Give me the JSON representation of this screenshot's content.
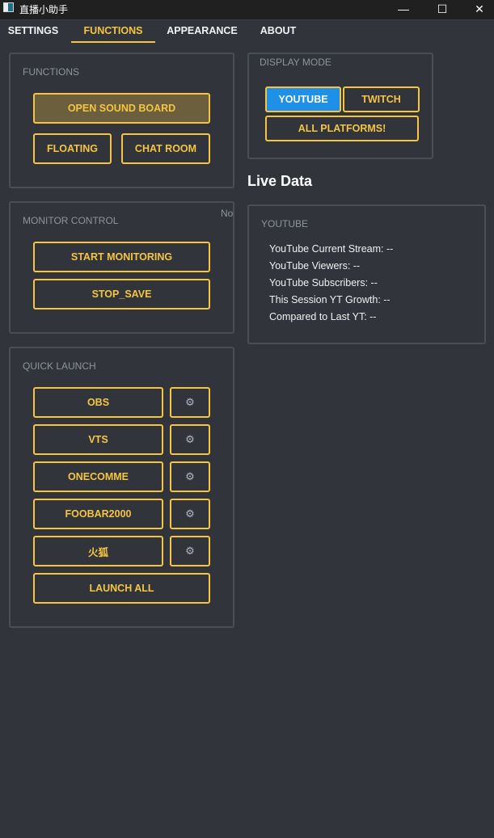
{
  "window": {
    "title": "直播小助手",
    "minimize": "—",
    "maximize": "☐",
    "close": "✕"
  },
  "tabs": [
    "SETTINGS",
    "FUNCTIONS",
    "APPEARANCE",
    "ABOUT"
  ],
  "functions": {
    "title": "FUNCTIONS",
    "open_sound_board": "OPEN SOUND BOARD",
    "floating": "FLOATING",
    "chat_room": "CHAT ROOM"
  },
  "monitor": {
    "title": "MONITOR CONTROL",
    "side_label": "No",
    "start": "START MONITORING",
    "stop_save": "STOP_SAVE"
  },
  "quick_launch": {
    "title": "QUICK LAUNCH",
    "items": [
      "OBS",
      "VTS",
      "ONECOMME",
      "FOOBAR2000",
      "火狐"
    ],
    "gear": "⚙",
    "launch_all": "LAUNCH ALL"
  },
  "display_mode": {
    "title": "DISPLAY MODE",
    "youtube": "YOUTUBE",
    "twitch": "TWITCH",
    "all": "ALL PLATFORMS!",
    "selected": "YOUTUBE"
  },
  "live_data": {
    "title": "Live Data",
    "group_title": "YOUTUBE",
    "stats": [
      "YouTube Current Stream: --",
      "YouTube Viewers: --",
      "YouTube Subscribers: --",
      "This Session YT Growth: --",
      "Compared to Last YT: --"
    ]
  },
  "colors": {
    "accent": "#f5c542",
    "selected_blue": "#1e90e8",
    "background": "#31353b"
  }
}
